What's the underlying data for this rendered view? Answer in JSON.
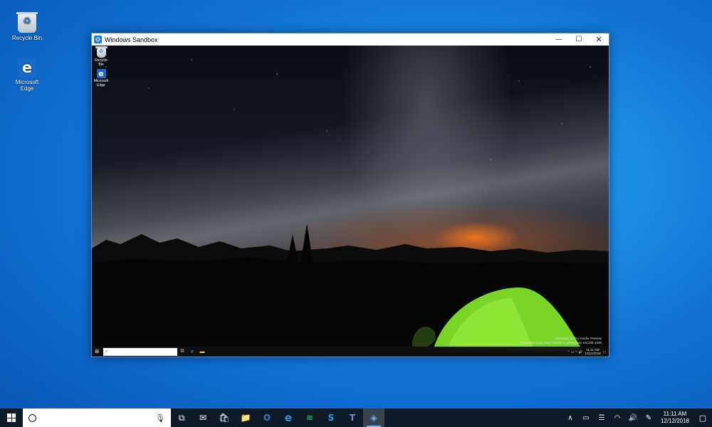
{
  "desktop": {
    "icons": [
      {
        "label": "Recycle Bin",
        "icon": "recycle-bin-icon"
      },
      {
        "label": "Microsoft Edge",
        "icon": "edge-icon"
      }
    ]
  },
  "sandbox_window": {
    "title": "Windows Sandbox",
    "controls": {
      "minimize": "—",
      "maximize": "☐",
      "close": "✕"
    },
    "inner_desktop": {
      "icons": [
        {
          "label": "Recycle Bin",
          "icon": "recycle-bin-icon"
        },
        {
          "label": "Microsoft Edge",
          "icon": "edge-icon"
        }
      ],
      "watermark_line1": "Windows 10 Pro Insider Preview",
      "watermark_line2": "Evaluation copy. Build 18305.rs_prerelease.181208-1930",
      "taskbar": {
        "search_placeholder": "",
        "time": "11:11 AM",
        "date": "12/12/2018"
      }
    }
  },
  "taskbar": {
    "start_icon": "windows-logo-icon",
    "search_icon": "cortana-circle-icon",
    "mic_icon": "microphone-icon",
    "pinned": [
      {
        "name": "task-view",
        "glyph": "⧉"
      },
      {
        "name": "mail",
        "glyph": "✉"
      },
      {
        "name": "store",
        "glyph": "🛍"
      },
      {
        "name": "file-explorer",
        "glyph": "📁"
      },
      {
        "name": "outlook",
        "glyph": "O"
      },
      {
        "name": "edge",
        "glyph": "e"
      },
      {
        "name": "spotify",
        "glyph": "≋"
      },
      {
        "name": "skype",
        "glyph": "S"
      },
      {
        "name": "teams",
        "glyph": "T"
      },
      {
        "name": "windows-sandbox",
        "glyph": "◈"
      }
    ],
    "tray": {
      "chevron": "∧",
      "battery": "▭",
      "network": "☰",
      "wifi": "◠",
      "volume": "🔊",
      "pen": "✎",
      "time": "11:11 AM",
      "date": "12/12/2018",
      "notification": "▢"
    }
  }
}
